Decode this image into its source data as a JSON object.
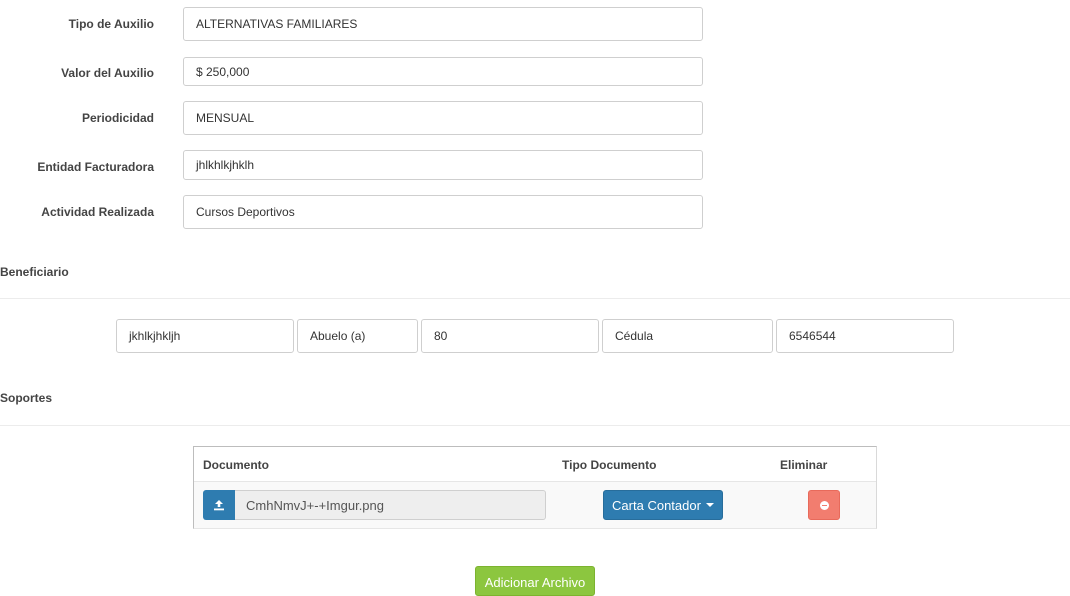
{
  "form": {
    "fields": [
      {
        "label": "Tipo de Auxilio",
        "value": "ALTERNATIVAS FAMILIARES"
      },
      {
        "label": "Valor del Auxilio",
        "value": "$ 250,000"
      },
      {
        "label": "Periodicidad",
        "value": "MENSUAL"
      },
      {
        "label": "Entidad Facturadora",
        "value": "jhlkhlkjhklh"
      },
      {
        "label": "Actividad Realizada",
        "value": "Cursos Deportivos"
      }
    ]
  },
  "beneficiario": {
    "title": "Beneficiario",
    "nombre": "jkhlkjhkljh",
    "parentesco": "Abuelo (a)",
    "edad": "80",
    "tipo_documento": "Cédula",
    "numero_documento": "6546544"
  },
  "soportes": {
    "title": "Soportes",
    "columns": {
      "documento": "Documento",
      "tipo_documento": "Tipo Documento",
      "eliminar": "Eliminar"
    },
    "rows": [
      {
        "file_name": "CmhNmvJ+-+Imgur.png",
        "tipo": "Carta Contador"
      }
    ],
    "add_button": "Adicionar Archivo"
  },
  "icons": {
    "upload": "upload-icon",
    "dropdown": "caret-down-icon",
    "remove": "minus-circle-icon"
  },
  "colors": {
    "primary": "#2e7cb0",
    "danger": "#f27d6f",
    "success": "#8cc63f"
  }
}
